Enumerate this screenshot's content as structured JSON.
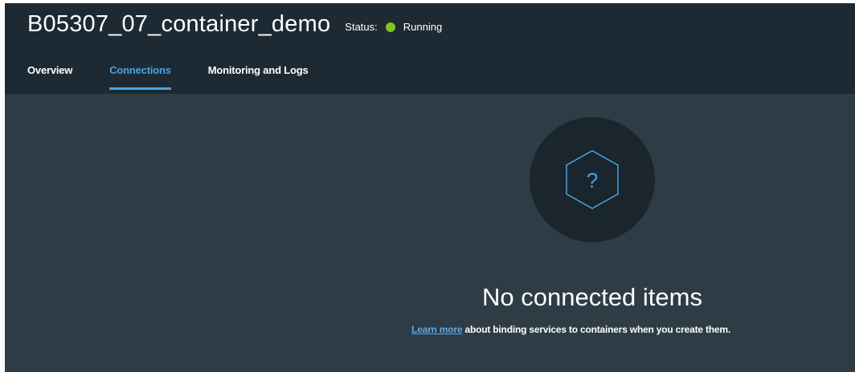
{
  "header": {
    "title": "B05307_07_container_demo",
    "status_label": "Status:",
    "status_value": "Running",
    "status_color": "#7cc51e"
  },
  "tabs": [
    {
      "label": "Overview",
      "active": false
    },
    {
      "label": "Connections",
      "active": true
    },
    {
      "label": "Monitoring and Logs",
      "active": false
    }
  ],
  "empty_state": {
    "icon": "question-hexagon-icon",
    "icon_glyph": "?",
    "title": "No connected items",
    "link_text": "Learn more",
    "description": "about binding services to containers when you create them."
  },
  "colors": {
    "accent": "#4aa3df",
    "header_bg": "#1e2a33",
    "body_bg": "#2e3c46"
  }
}
